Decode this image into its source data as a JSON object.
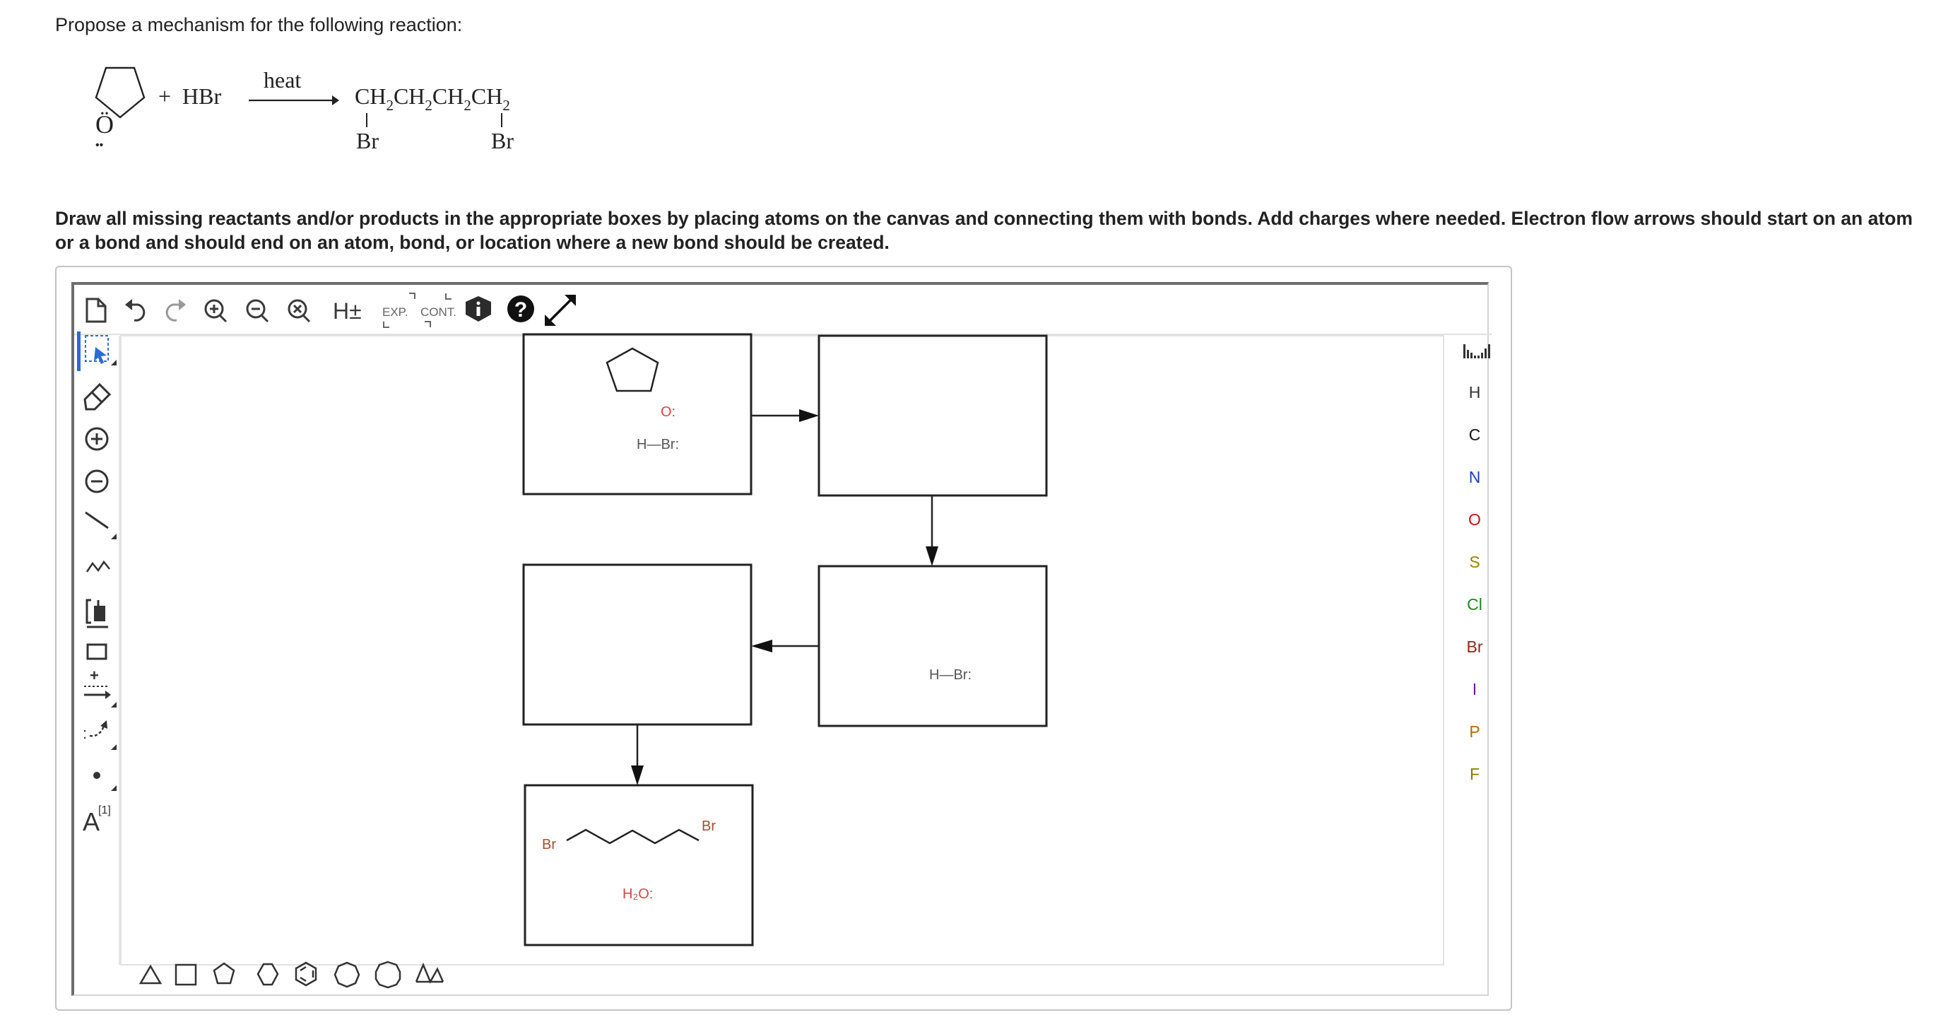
{
  "question": {
    "prompt": "Propose a mechanism for the following reaction:",
    "instructions": "Draw all missing reactants and/or products in the appropriate boxes by placing atoms on the canvas and connecting them with bonds. Add charges where needed. Electron flow arrows should start on an atom or a bond and should end on an atom, bond, or location where a new bond should be created."
  },
  "reaction": {
    "reactant_atom": "Ö",
    "plus_reagent": "+  HBr",
    "condition": "heat",
    "product_chain_segments": [
      "CH",
      "2",
      "CH",
      "2",
      "CH",
      "2",
      "CH",
      "2"
    ],
    "product_substituent_left": "Br",
    "product_substituent_right": "Br"
  },
  "toolbar": {
    "hydrogen_toggle": "H±",
    "expand_label": "EXP.",
    "contract_label": "CONT."
  },
  "elements": [
    {
      "symbol": "H",
      "color": "#333333"
    },
    {
      "symbol": "C",
      "color": "#111111"
    },
    {
      "symbol": "N",
      "color": "#1a3fb8"
    },
    {
      "symbol": "O",
      "color": "#c81414"
    },
    {
      "symbol": "S",
      "color": "#a08000"
    },
    {
      "symbol": "Cl",
      "color": "#1a8a1a"
    },
    {
      "symbol": "Br",
      "color": "#8b2a15"
    },
    {
      "symbol": "I",
      "color": "#6a1a9a"
    },
    {
      "symbol": "P",
      "color": "#b86a00"
    },
    {
      "symbol": "F",
      "color": "#8a7a00"
    }
  ],
  "left_tools": {
    "atom_map_label": "A",
    "atom_map_index": "[1]"
  },
  "canvas": {
    "box1_atom": "O:",
    "box1_hbr": "H—Br:",
    "box4_hbr": "H—Br:",
    "box5_br_left": "Br",
    "box5_br_right": "Br",
    "box5_water": "H₂O:"
  },
  "colors": {
    "heteroatom": "#d64545",
    "toolbar_icon": "#3a3a3a",
    "select_accent": "#2a6ad6",
    "box_border": "#222222"
  }
}
